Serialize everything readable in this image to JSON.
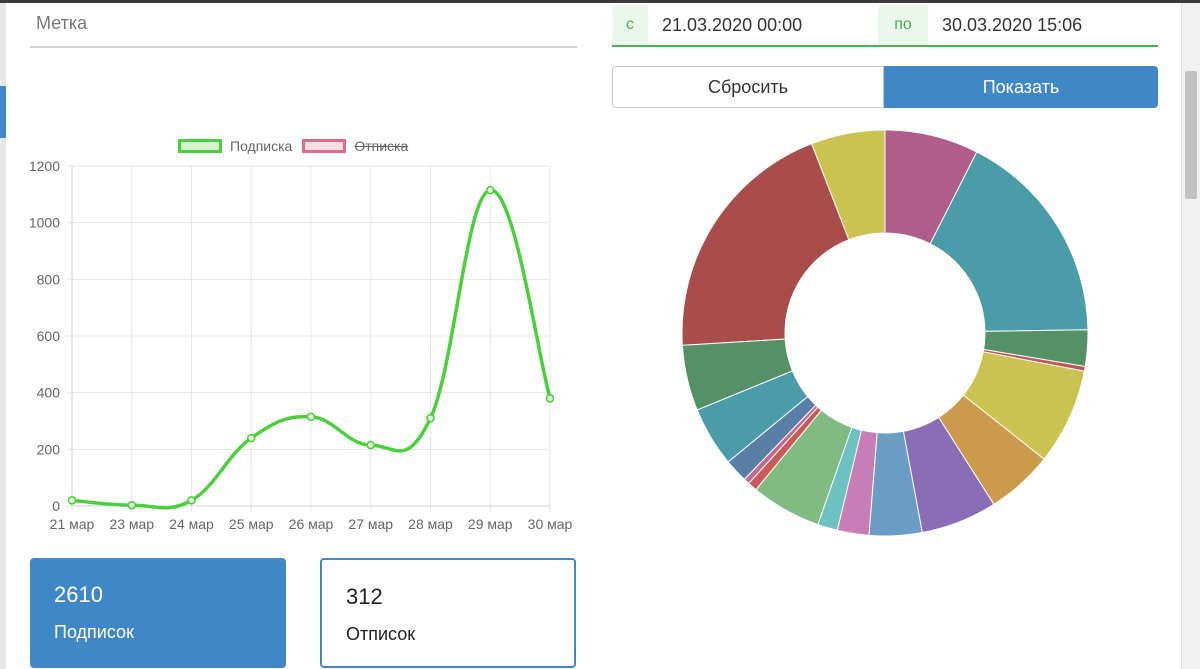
{
  "filters": {
    "label_placeholder": "Метка",
    "from_prefix": "с",
    "from_value": "21.03.2020 00:00",
    "to_prefix": "по",
    "to_value": "30.03.2020 15:06"
  },
  "buttons": {
    "reset_label": "Сбросить",
    "show_label": "Показать"
  },
  "stats": {
    "subscriptions_value": "2610",
    "subscriptions_label": "Подписок",
    "unsubscriptions_value": "312",
    "unsubscriptions_label": "Отписок"
  },
  "colors": {
    "accent": "#3f87c6",
    "subscribe_line": "#4ccf3c",
    "unsubscribe_line": "#e06b8a",
    "active_underline": "#4caf50"
  },
  "chart_data": [
    {
      "type": "line",
      "title": "",
      "xlabel": "",
      "ylabel": "",
      "categories": [
        "21 мар",
        "23 мар",
        "24 мар",
        "25 мар",
        "26 мар",
        "27 мар",
        "28 мар",
        "29 мар",
        "30 мар"
      ],
      "ylim": [
        0,
        1200
      ],
      "yticks": [
        0,
        200,
        400,
        600,
        800,
        1000,
        1200
      ],
      "grid": true,
      "legend_position": "top",
      "series": [
        {
          "name": "Подписка",
          "color": "#4ccf3c",
          "hidden": false,
          "values": [
            20,
            3,
            20,
            240,
            315,
            215,
            310,
            1115,
            380
          ]
        },
        {
          "name": "Отписка",
          "color": "#e06b8a",
          "hidden": true,
          "values": []
        }
      ]
    },
    {
      "type": "pie",
      "variant": "doughnut",
      "slices": [
        {
          "value": 8.0,
          "color": "#b05d8e"
        },
        {
          "value": 18.5,
          "color": "#4a9ca8"
        },
        {
          "value": 3.1,
          "color": "#559166"
        },
        {
          "value": 0.4,
          "color": "#c0565a"
        },
        {
          "value": 8.2,
          "color": "#cbc350"
        },
        {
          "value": 5.7,
          "color": "#cc9a4d"
        },
        {
          "value": 6.5,
          "color": "#8b6db6"
        },
        {
          "value": 4.5,
          "color": "#6a9dc6"
        },
        {
          "value": 2.7,
          "color": "#c77db5"
        },
        {
          "value": 1.7,
          "color": "#6cc2c2"
        },
        {
          "value": 6.0,
          "color": "#80bb82"
        },
        {
          "value": 0.8,
          "color": "#c85a5a"
        },
        {
          "value": 0.5,
          "color": "#c26a8e"
        },
        {
          "value": 2.0,
          "color": "#5a7fa6"
        },
        {
          "value": 5.1,
          "color": "#4a9ca8"
        },
        {
          "value": 5.6,
          "color": "#559166"
        },
        {
          "value": 21.5,
          "color": "#a84c4c"
        },
        {
          "value": 6.3,
          "color": "#cbc350"
        }
      ]
    }
  ]
}
